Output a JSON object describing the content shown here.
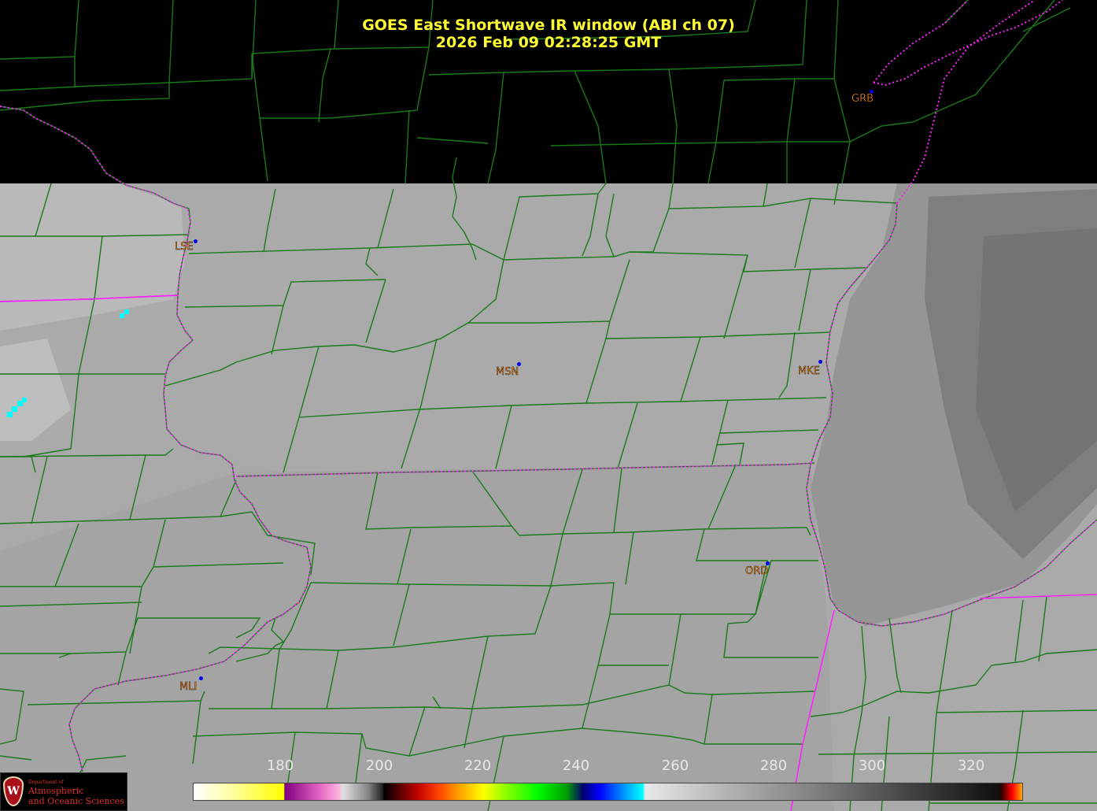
{
  "title": {
    "line1": "GOES East Shortwave IR window (ABI ch 07)",
    "line2": "2026 Feb 09  02:28:25 GMT"
  },
  "stations": [
    {
      "id": "GRB"
    },
    {
      "id": "LSE"
    },
    {
      "id": "MSN"
    },
    {
      "id": "MKE"
    },
    {
      "id": "ORD"
    },
    {
      "id": "MLI"
    }
  ],
  "colorbar": {
    "ticks": [
      "180",
      "200",
      "220",
      "240",
      "260",
      "280",
      "300",
      "320"
    ]
  },
  "logo": {
    "department": "Department of",
    "name_line1": "Atmospheric",
    "name_line2": "and Oceanic Sciences",
    "crest_letter": "W"
  },
  "colors": {
    "title": "#ffff33",
    "county_lines": "#1a7a1a",
    "state_borders": "#ff33ff",
    "station_label": "#ff8c1a",
    "station_dot": "#0000ee",
    "cold_pixels": "#00ffff"
  }
}
